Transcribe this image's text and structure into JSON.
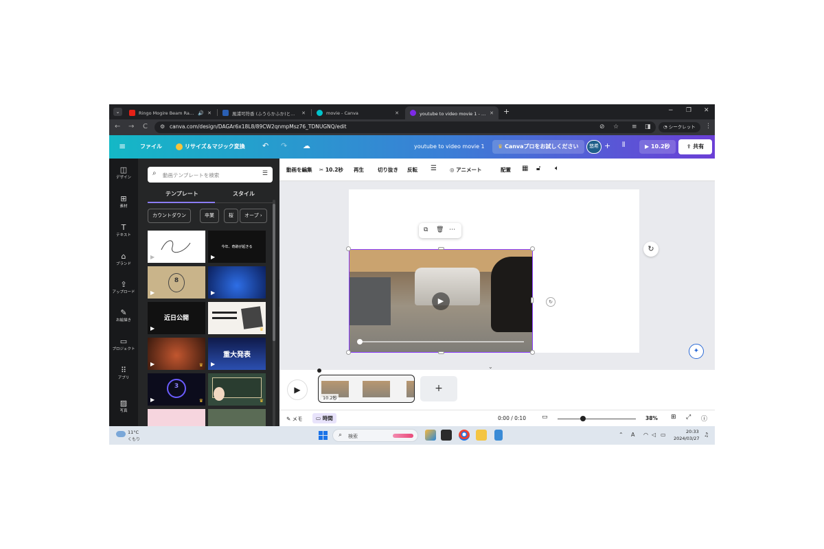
{
  "browser": {
    "tabs": [
      {
        "title": "Ringo Mogire Beam Rap! -",
        "favicon_color": "#e62117"
      },
      {
        "title": "風浦可符香 (ふうらかふか)とは【ピク",
        "favicon_color": "#2a5fb4"
      },
      {
        "title": "movie - Canva",
        "favicon_color": "#00c4cc"
      },
      {
        "title": "youtube to video movie 1 - 動画",
        "favicon_color": "#7d2ae8"
      }
    ],
    "audio_glyph": "🔊",
    "close_glyph": "✕",
    "new_tab_glyph": "+",
    "window_controls": {
      "minimize": "−",
      "restore": "❐",
      "close": "✕"
    },
    "nav": {
      "back": "←",
      "forward": "→",
      "reload": "C"
    },
    "url": "canva.com/design/DAGAr6x18L8/89CW2qnmpMsz76_TDNUGNQ/edit",
    "incognito_label": "シークレット"
  },
  "canva": {
    "header": {
      "file_label": "ファイル",
      "resize_label": "リサイズ＆マジック変換",
      "title": "youtube to video movie 1",
      "try_pro_label": "Canvaプロをお試しください",
      "avatar_label": "悠希",
      "plus_glyph": "+",
      "play_label": "10.2秒",
      "share_label": "共有"
    },
    "rail": [
      {
        "label": "デザイン",
        "icon": "layout-icon",
        "glyph": "◫"
      },
      {
        "label": "素材",
        "icon": "elements-icon",
        "glyph": "⊞"
      },
      {
        "label": "テキスト",
        "icon": "text-icon",
        "glyph": "T"
      },
      {
        "label": "ブランド",
        "icon": "brand-icon",
        "glyph": "⌂"
      },
      {
        "label": "アップロード",
        "icon": "upload-icon",
        "glyph": "⇪"
      },
      {
        "label": "お絵描き",
        "icon": "draw-icon",
        "glyph": "✎"
      },
      {
        "label": "プロジェクト",
        "icon": "folder-icon",
        "glyph": "▭"
      },
      {
        "label": "アプリ",
        "icon": "apps-icon",
        "glyph": "⠿"
      },
      {
        "label": "写真",
        "icon": "photo-icon",
        "glyph": "▨"
      }
    ],
    "panel": {
      "search_placeholder": "動画テンプレートを検索",
      "tabs": [
        "テンプレート",
        "スタイル"
      ],
      "chips": [
        "カウントダウン",
        "卒業",
        "桜",
        "オープ"
      ],
      "thumbnails": [
        {
          "text": "",
          "bg": "#ffffff"
        },
        {
          "text": "今年、奇跡が起きる",
          "bg": "#111111"
        },
        {
          "text": "8",
          "bg": "#c9b48a"
        },
        {
          "text": "",
          "bg": "#143a8c"
        },
        {
          "text": "近日公開",
          "bg": "#111111"
        },
        {
          "text": "",
          "bg": "#f4f1ec"
        },
        {
          "text": "",
          "bg": "#7a3b22"
        },
        {
          "text": "重大発表",
          "bg": "#1c2d6b"
        },
        {
          "text": "3",
          "bg": "#0c0c1c"
        },
        {
          "text": "",
          "bg": "#334a3c"
        },
        {
          "text": "",
          "bg": "#f6d5de"
        },
        {
          "text": "",
          "bg": "#5a6b55"
        }
      ]
    },
    "toolbar": {
      "edit_video": "動画を編集",
      "duration": "10.2秒",
      "playback": "再生",
      "crop": "切り抜き",
      "flip": "反転",
      "animate": "アニメート",
      "position": "配置"
    },
    "timeline": {
      "clip_duration": "10.2秒",
      "add_glyph": "+"
    },
    "status": {
      "notes_label": "メモ",
      "time_label": "時間",
      "time_readout": "0:00 / 0:10",
      "zoom": "38%"
    },
    "accent_color": "#8b3dff"
  },
  "taskbar": {
    "temperature": "11°C",
    "weather": "くもり",
    "search_placeholder": "検索",
    "time": "20:33",
    "date": "2024/03/27"
  }
}
